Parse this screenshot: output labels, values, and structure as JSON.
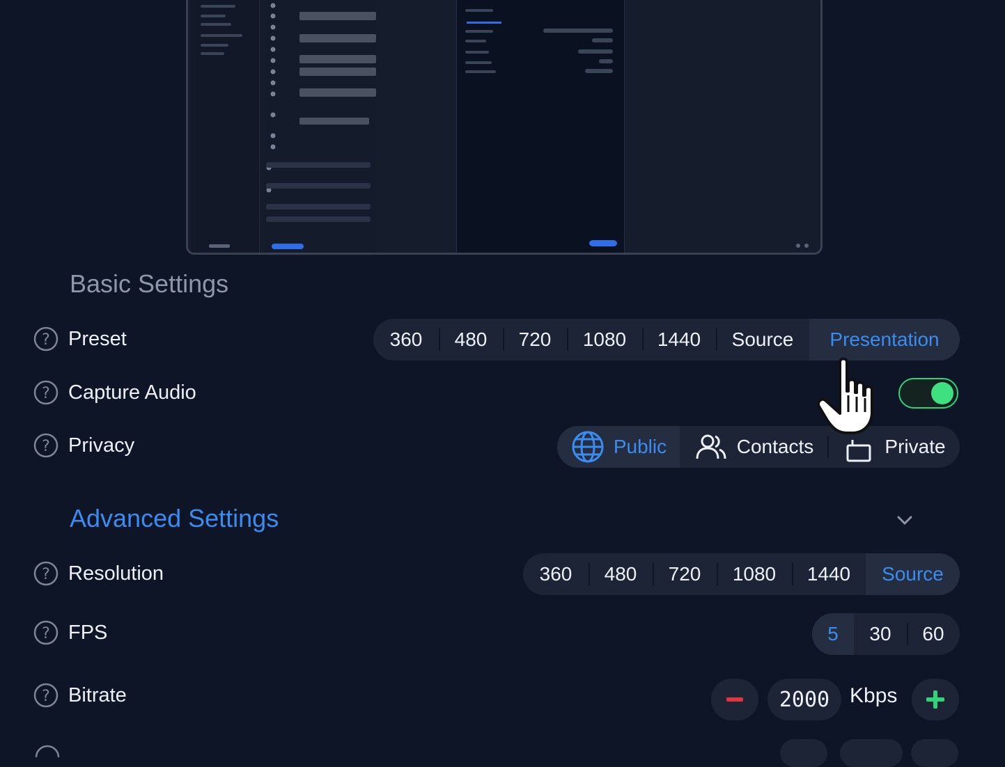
{
  "basic_settings": {
    "title": "Basic Settings",
    "preset": {
      "label": "Preset",
      "options": [
        "360",
        "480",
        "720",
        "1080",
        "1440",
        "Source",
        "Presentation"
      ],
      "selected": "Presentation"
    },
    "capture_audio": {
      "label": "Capture Audio",
      "enabled": true
    },
    "privacy": {
      "label": "Privacy",
      "options": [
        {
          "label": "Public",
          "icon": "globe-icon"
        },
        {
          "label": "Contacts",
          "icon": "users-icon"
        },
        {
          "label": "Private",
          "icon": "lock-icon"
        }
      ],
      "selected": "Public"
    }
  },
  "advanced_settings": {
    "title": "Advanced Settings",
    "expanded": true,
    "resolution": {
      "label": "Resolution",
      "options": [
        "360",
        "480",
        "720",
        "1080",
        "1440",
        "Source"
      ],
      "selected": "Source"
    },
    "fps": {
      "label": "FPS",
      "options": [
        "5",
        "30",
        "60"
      ],
      "selected": "5"
    },
    "bitrate": {
      "label": "Bitrate",
      "value": "2000",
      "unit": "Kbps"
    }
  },
  "colors": {
    "background": "#0d1526",
    "accent": "#3b8cf0",
    "toggle_on": "#3ee07f",
    "decrement": "#e0343f",
    "increment": "#34d17b"
  }
}
